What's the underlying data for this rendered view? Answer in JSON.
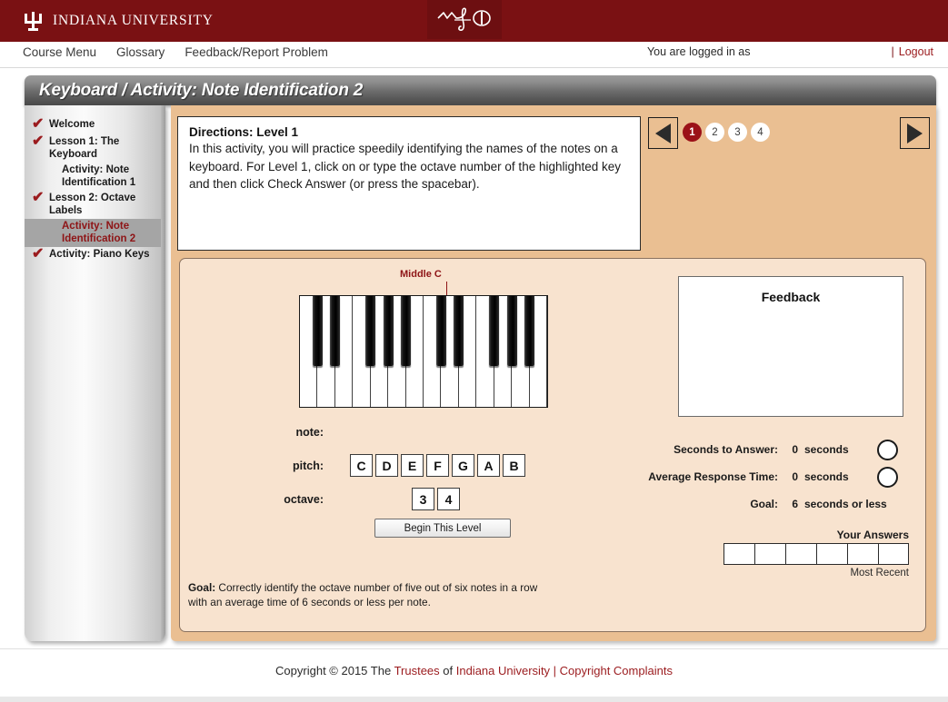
{
  "header": {
    "wordmark": "INDIANA UNIVERSITY",
    "trident_icon": "iu-trident-icon",
    "music_logo_icon": "music-script-logo-icon"
  },
  "navbar": {
    "links": [
      {
        "label": "Course Menu",
        "name": "nav-course-menu"
      },
      {
        "label": "Glossary",
        "name": "nav-glossary"
      },
      {
        "label": "Feedback/Report Problem",
        "name": "nav-feedback-report-problem"
      }
    ],
    "logged_in_text": "You are logged in as",
    "separator": "|",
    "logout_label": "Logout"
  },
  "page": {
    "title": "Keyboard / Activity: Note Identification 2"
  },
  "sidebar": {
    "items": [
      {
        "label": "Welcome",
        "checked": true,
        "sub": false,
        "active": false
      },
      {
        "label": "Lesson 1: The Keyboard",
        "checked": true,
        "sub": false,
        "active": false
      },
      {
        "label": "Activity: Note Identification 1",
        "checked": false,
        "sub": true,
        "active": false
      },
      {
        "label": "Lesson 2: Octave Labels",
        "checked": true,
        "sub": false,
        "active": false
      },
      {
        "label": "Activity: Note Identification 2",
        "checked": false,
        "sub": true,
        "active": true
      },
      {
        "label": "Activity: Piano Keys",
        "checked": true,
        "sub": true,
        "active": false
      }
    ],
    "check_glyph": "✔"
  },
  "directions": {
    "title": "Directions: Level 1",
    "body": "In this activity, you will practice speedily identifying the names of the notes on a keyboard. For Level 1, click on or type the octave number of the highlighted key and then click Check Answer (or press the spacebar)."
  },
  "level_nav": {
    "prev_icon": "previous-arrow-icon",
    "next_icon": "next-arrow-icon",
    "levels": [
      "1",
      "2",
      "3",
      "4"
    ],
    "selected_level": "1",
    "selected_color": "#9b1118"
  },
  "piano": {
    "middle_c_label": "Middle C",
    "white_key_count": 14,
    "black_key_count": 10,
    "middle_c_white_index": 7,
    "marker_color": "#8e1416"
  },
  "answers": {
    "note_label": "note:",
    "note_value": "",
    "pitch_label": "pitch:",
    "pitch_options": [
      "C",
      "D",
      "E",
      "F",
      "G",
      "A",
      "B"
    ],
    "octave_label": "octave:",
    "octave_options": [
      "3",
      "4"
    ],
    "begin_button": "Begin This Level"
  },
  "goal": {
    "prefix": "Goal:",
    "text": " Correctly identify the octave number of five out of six notes in a row with an average time of 6 seconds or less per note."
  },
  "feedback": {
    "title": "Feedback",
    "message": ""
  },
  "stats": {
    "rows": [
      {
        "label": "Seconds to Answer:",
        "value": "0",
        "unit": "seconds",
        "has_circle": true
      },
      {
        "label": "Average Response Time:",
        "value": "0",
        "unit": "seconds",
        "has_circle": true
      },
      {
        "label": "Goal:",
        "value": "6",
        "unit": "seconds or less",
        "has_circle": false
      }
    ]
  },
  "your_answers": {
    "title": "Your Answers",
    "cells": [
      "",
      "",
      "",
      "",
      "",
      ""
    ],
    "most_recent_label": "Most Recent"
  },
  "footer": {
    "copyright_prefix": "Copyright © 2015 The ",
    "trustees_link": "Trustees",
    "of_text": " of ",
    "university_link": "Indiana University",
    "separator": " | ",
    "complaints_link": "Copyright Complaints"
  }
}
